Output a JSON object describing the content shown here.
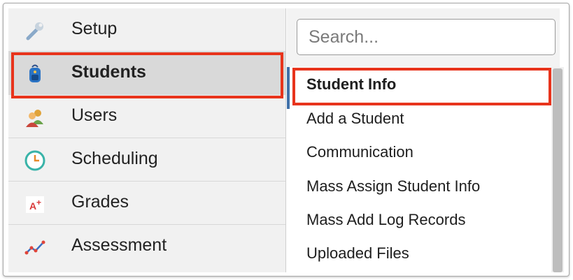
{
  "nav": {
    "items": [
      {
        "label": "Setup",
        "icon": "wrench-icon",
        "active": false
      },
      {
        "label": "Students",
        "icon": "backpack-icon",
        "active": true
      },
      {
        "label": "Users",
        "icon": "users-icon",
        "active": false
      },
      {
        "label": "Scheduling",
        "icon": "clock-icon",
        "active": false
      },
      {
        "label": "Grades",
        "icon": "grade-a-plus-icon",
        "active": false
      },
      {
        "label": "Assessment",
        "icon": "line-chart-icon",
        "active": false
      }
    ]
  },
  "search": {
    "placeholder": "Search..."
  },
  "submenu": {
    "items": [
      {
        "label": "Student Info",
        "active": true
      },
      {
        "label": "Add a Student",
        "active": false
      },
      {
        "label": "Communication",
        "active": false
      },
      {
        "label": "Mass Assign Student Info",
        "active": false
      },
      {
        "label": "Mass Add Log Records",
        "active": false
      },
      {
        "label": "Uploaded Files",
        "active": false
      }
    ]
  },
  "colors": {
    "highlight": "#e8341c",
    "accent": "#3f6fa8",
    "active_bg": "#d9d9d9"
  }
}
